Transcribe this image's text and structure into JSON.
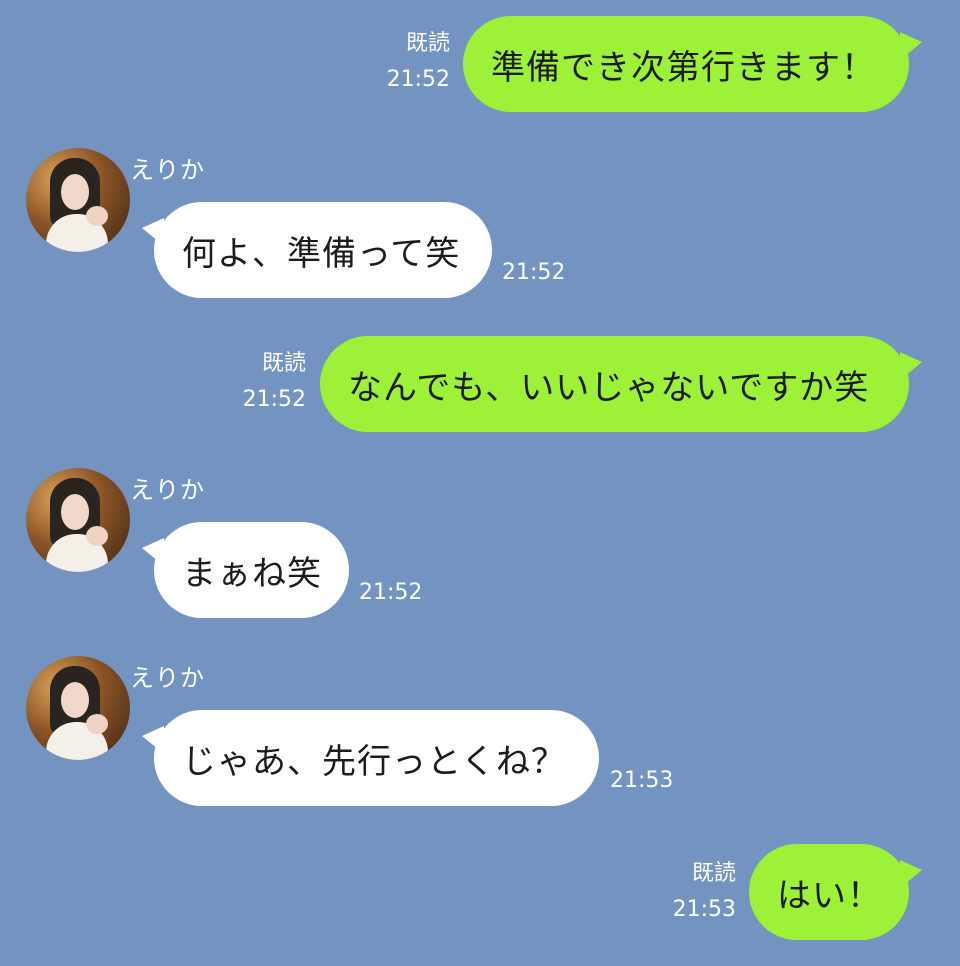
{
  "colors": {
    "background": "#7394c0",
    "outgoing_bubble": "#9df238",
    "incoming_bubble": "#ffffff",
    "meta_text": "#ffffff"
  },
  "messages": [
    {
      "from": "me",
      "text": "準備でき次第行きます！",
      "read": "既読",
      "time": "21:52"
    },
    {
      "from": "erika",
      "sender": "えりか",
      "text": "何よ、準備って笑",
      "time": "21:52"
    },
    {
      "from": "me",
      "text": "なんでも、いいじゃないですか笑",
      "read": "既読",
      "time": "21:52"
    },
    {
      "from": "erika",
      "sender": "えりか",
      "text": "まぁね笑",
      "time": "21:52"
    },
    {
      "from": "erika",
      "sender": "えりか",
      "text": "じゃあ、先行っとくね？",
      "time": "21:53"
    },
    {
      "from": "me",
      "text": "はい！",
      "read": "既読",
      "time": "21:53"
    }
  ]
}
